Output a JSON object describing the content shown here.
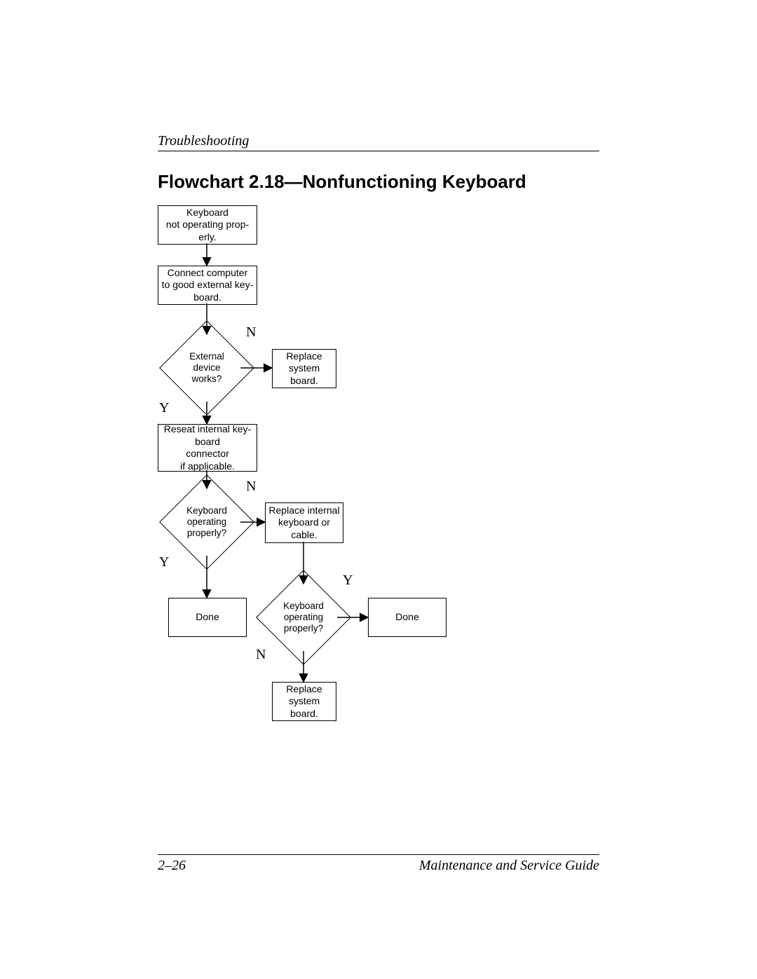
{
  "header": {
    "section": "Troubleshooting"
  },
  "title": "Flowchart 2.18—Nonfunctioning Keyboard",
  "footer": {
    "page": "2–26",
    "doc": "Maintenance and Service Guide"
  },
  "labels": {
    "yes": "Y",
    "no": "N"
  },
  "nodes": {
    "start": "Keyboard\nnot operating prop-\nerly.",
    "connect": "Connect computer\nto good external key-\nboard.",
    "dec_external": "External\ndevice\nworks?",
    "replace_sys_1": "Replace\nsystem\nboard.",
    "reseat": "Reseat internal key-\nboard\nconnector\nif applicable.",
    "dec_kbd_1": "Keyboard\noperating\nproperly?",
    "replace_internal": "Replace internal\nkeyboard or\ncable.",
    "done_1": "Done",
    "dec_kbd_2": "Keyboard\noperating\nproperly?",
    "done_2": "Done",
    "replace_sys_2": "Replace\nsystem\nboard."
  },
  "chart_data": {
    "type": "flowchart",
    "title": "Flowchart 2.18—Nonfunctioning Keyboard",
    "nodes": [
      {
        "id": "start",
        "shape": "terminator",
        "text": "Keyboard not operating properly."
      },
      {
        "id": "connect",
        "shape": "process",
        "text": "Connect computer to good external keyboard."
      },
      {
        "id": "dec_external",
        "shape": "decision",
        "text": "External device works?"
      },
      {
        "id": "replace_sys_1",
        "shape": "process",
        "text": "Replace system board."
      },
      {
        "id": "reseat",
        "shape": "process",
        "text": "Reseat internal keyboard connector if applicable."
      },
      {
        "id": "dec_kbd_1",
        "shape": "decision",
        "text": "Keyboard operating properly?"
      },
      {
        "id": "replace_internal",
        "shape": "process",
        "text": "Replace internal keyboard or cable."
      },
      {
        "id": "done_1",
        "shape": "terminator",
        "text": "Done"
      },
      {
        "id": "dec_kbd_2",
        "shape": "decision",
        "text": "Keyboard operating properly?"
      },
      {
        "id": "done_2",
        "shape": "terminator",
        "text": "Done"
      },
      {
        "id": "replace_sys_2",
        "shape": "process",
        "text": "Replace system board."
      }
    ],
    "edges": [
      {
        "from": "start",
        "to": "connect",
        "label": ""
      },
      {
        "from": "connect",
        "to": "dec_external",
        "label": ""
      },
      {
        "from": "dec_external",
        "to": "replace_sys_1",
        "label": "N"
      },
      {
        "from": "dec_external",
        "to": "reseat",
        "label": "Y"
      },
      {
        "from": "reseat",
        "to": "dec_kbd_1",
        "label": ""
      },
      {
        "from": "dec_kbd_1",
        "to": "replace_internal",
        "label": "N"
      },
      {
        "from": "dec_kbd_1",
        "to": "done_1",
        "label": "Y"
      },
      {
        "from": "replace_internal",
        "to": "dec_kbd_2",
        "label": ""
      },
      {
        "from": "dec_kbd_2",
        "to": "done_2",
        "label": "Y"
      },
      {
        "from": "dec_kbd_2",
        "to": "replace_sys_2",
        "label": "N"
      }
    ]
  }
}
